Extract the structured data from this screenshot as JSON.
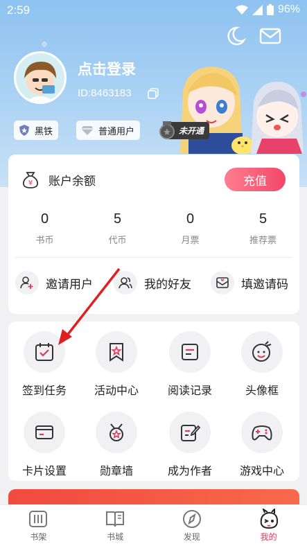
{
  "status_bar": {
    "time": "2:59",
    "battery": "96%"
  },
  "profile": {
    "login_title": "点击登录",
    "user_id": "ID:8463183",
    "level_badge": "黑铁",
    "member_badge": "普通用户",
    "locked_badge": "未开通"
  },
  "account": {
    "title": "账户余额",
    "recharge_label": "充值",
    "stats": [
      {
        "value": "0",
        "label": "书币"
      },
      {
        "value": "5",
        "label": "代币"
      },
      {
        "value": "0",
        "label": "月票"
      },
      {
        "value": "5",
        "label": "推荐票"
      }
    ],
    "links": [
      {
        "label": "邀请用户"
      },
      {
        "label": "我的好友"
      },
      {
        "label": "填邀请码"
      }
    ]
  },
  "features": [
    {
      "label": "签到任务",
      "icon": "calendar-check-icon"
    },
    {
      "label": "活动中心",
      "icon": "star-bookmark-icon"
    },
    {
      "label": "阅读记录",
      "icon": "document-icon"
    },
    {
      "label": "头像框",
      "icon": "face-icon"
    },
    {
      "label": "卡片设置",
      "icon": "card-icon"
    },
    {
      "label": "勋章墙",
      "icon": "medal-icon"
    },
    {
      "label": "成为作者",
      "icon": "pen-edit-icon"
    },
    {
      "label": "游戏中心",
      "icon": "gamepad-icon"
    }
  ],
  "tabs": [
    {
      "label": "书架",
      "icon": "bookshelf-icon",
      "active": false
    },
    {
      "label": "书城",
      "icon": "book-open-icon",
      "active": false
    },
    {
      "label": "发现",
      "icon": "compass-icon",
      "active": false
    },
    {
      "label": "我的",
      "icon": "mascot-icon",
      "active": true
    }
  ],
  "colors": {
    "accent": "#e8355a",
    "hero_bg": "#9cc8f2",
    "promo": "#f14a3e"
  }
}
